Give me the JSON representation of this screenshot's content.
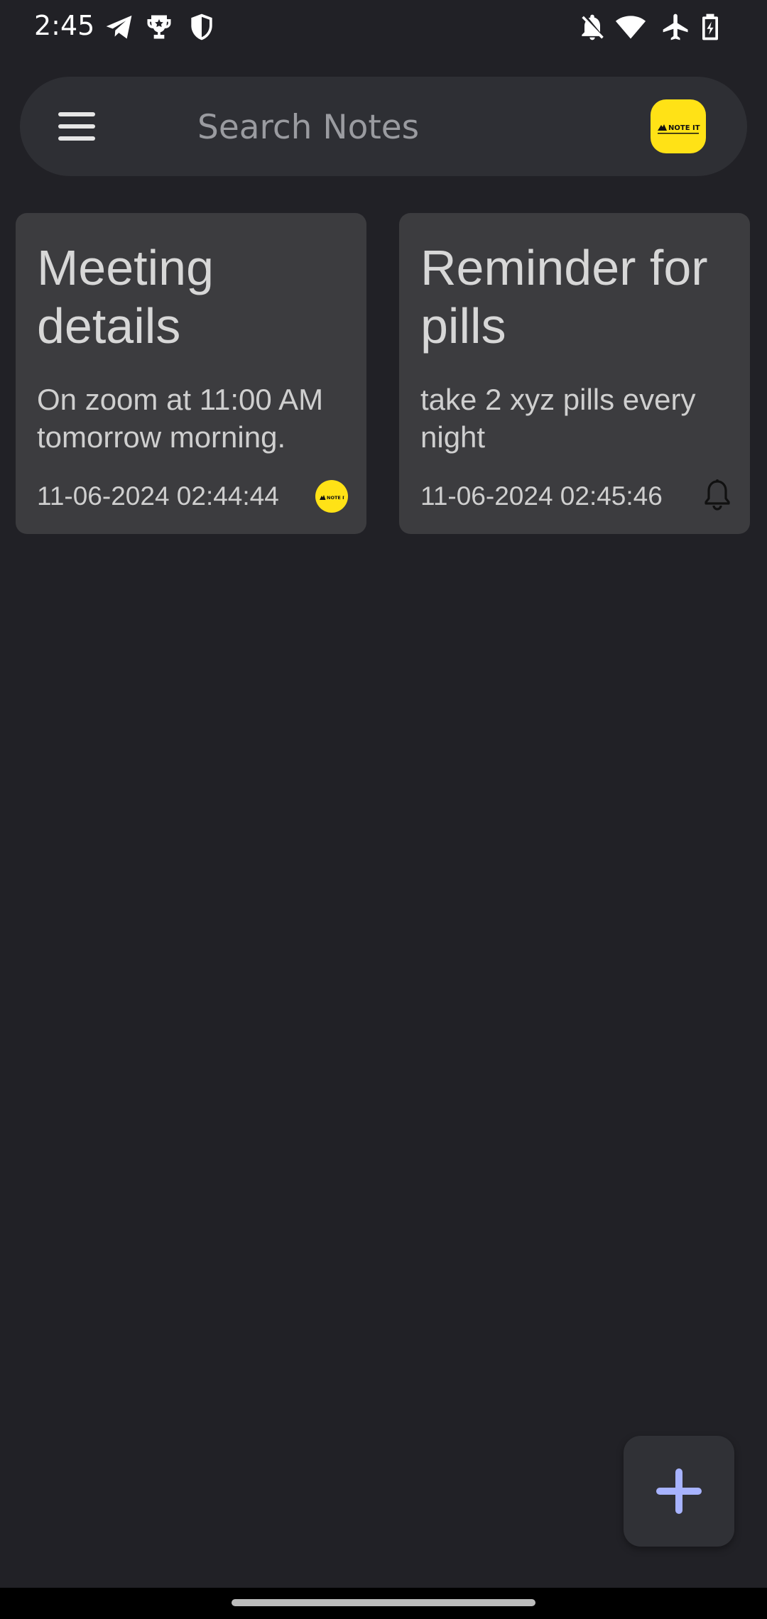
{
  "status_bar": {
    "time": "2:45",
    "left_icons": [
      "telegram-icon",
      "trophy-icon",
      "shield-icon"
    ],
    "right_icons": [
      "notifications-off-icon",
      "wifi-icon",
      "airplane-mode-icon",
      "battery-charging-icon"
    ]
  },
  "search": {
    "placeholder": "Search Notes",
    "value": "",
    "menu_icon": "hamburger-menu-icon",
    "logo_text": "NOTE IT",
    "logo_color": "#ffe216"
  },
  "notes": [
    {
      "title": "Meeting details",
      "body": "On zoom at 11:00 AM tomorrow morning.",
      "timestamp": "11-06-2024 02:44:44",
      "badge_icon": "note-it-logo-icon",
      "badge_text": "NOTE IT"
    },
    {
      "title": "Reminder for pills",
      "body": "take 2 xyz pills every night",
      "timestamp": "11-06-2024 02:45:46",
      "badge_icon": "bell-icon"
    }
  ],
  "fab": {
    "icon": "plus-icon",
    "accent": "#a7b3ff"
  },
  "colors": {
    "background": "#212126",
    "search_bar": "#2e2f34",
    "card": "#3c3c3f",
    "logo_yellow": "#ffe216"
  }
}
